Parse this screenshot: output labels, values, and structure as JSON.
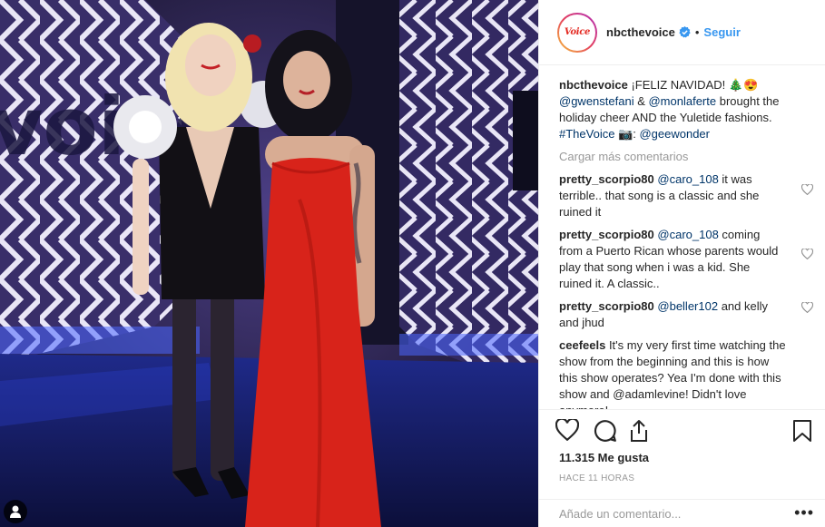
{
  "post": {
    "username": "nbcthevoice",
    "avatar_text": "Voice",
    "follow_label": "Seguir",
    "separator": "•",
    "image_watermark": "voice"
  },
  "caption": {
    "username": "nbcthevoice",
    "t1": " ¡FELIZ NAVIDAD! 🎄😍 ",
    "m1": "@gwenstefani",
    "t2": " & ",
    "m2": "@monlaferte",
    "t3": " brought the holiday cheer AND the Yuletide fashions. ",
    "tag": "#TheVoice",
    "t4": " 📷: ",
    "m3": "@geewonder"
  },
  "load_more": "Cargar más comentarios",
  "comments": [
    {
      "username": "pretty_scorpio80",
      "mention": "@caro_108",
      "text": " it was terrible.. that song is a classic and she ruined it"
    },
    {
      "username": "pretty_scorpio80",
      "mention": "@caro_108",
      "text": " coming from a Puerto Rican whose parents would play that song when i was a kid. She ruined it. A classic.."
    },
    {
      "username": "pretty_scorpio80",
      "mention": "@beller102",
      "text": " and kelly and jhud"
    },
    {
      "username": "ceefeels",
      "mention": "",
      "text": " It's my very first time watching the show from the beginning and this is how this show operates? Yea I'm done with this show and @adamlevine! Didn't love anymore!"
    }
  ],
  "likes": "11.315 Me gusta",
  "time_ago": "HACE 11 HORAS",
  "add_comment_placeholder": "Añade un comentario...",
  "more_dots": "•••",
  "icons": [
    "verified-badge-icon",
    "heart-icon",
    "comment-icon",
    "share-icon",
    "bookmark-icon",
    "more-options-icon",
    "user-tag-icon"
  ],
  "colors": {
    "link": "#003569",
    "follow": "#3897f0",
    "muted": "#999999",
    "dress_red": "#d8231a"
  }
}
